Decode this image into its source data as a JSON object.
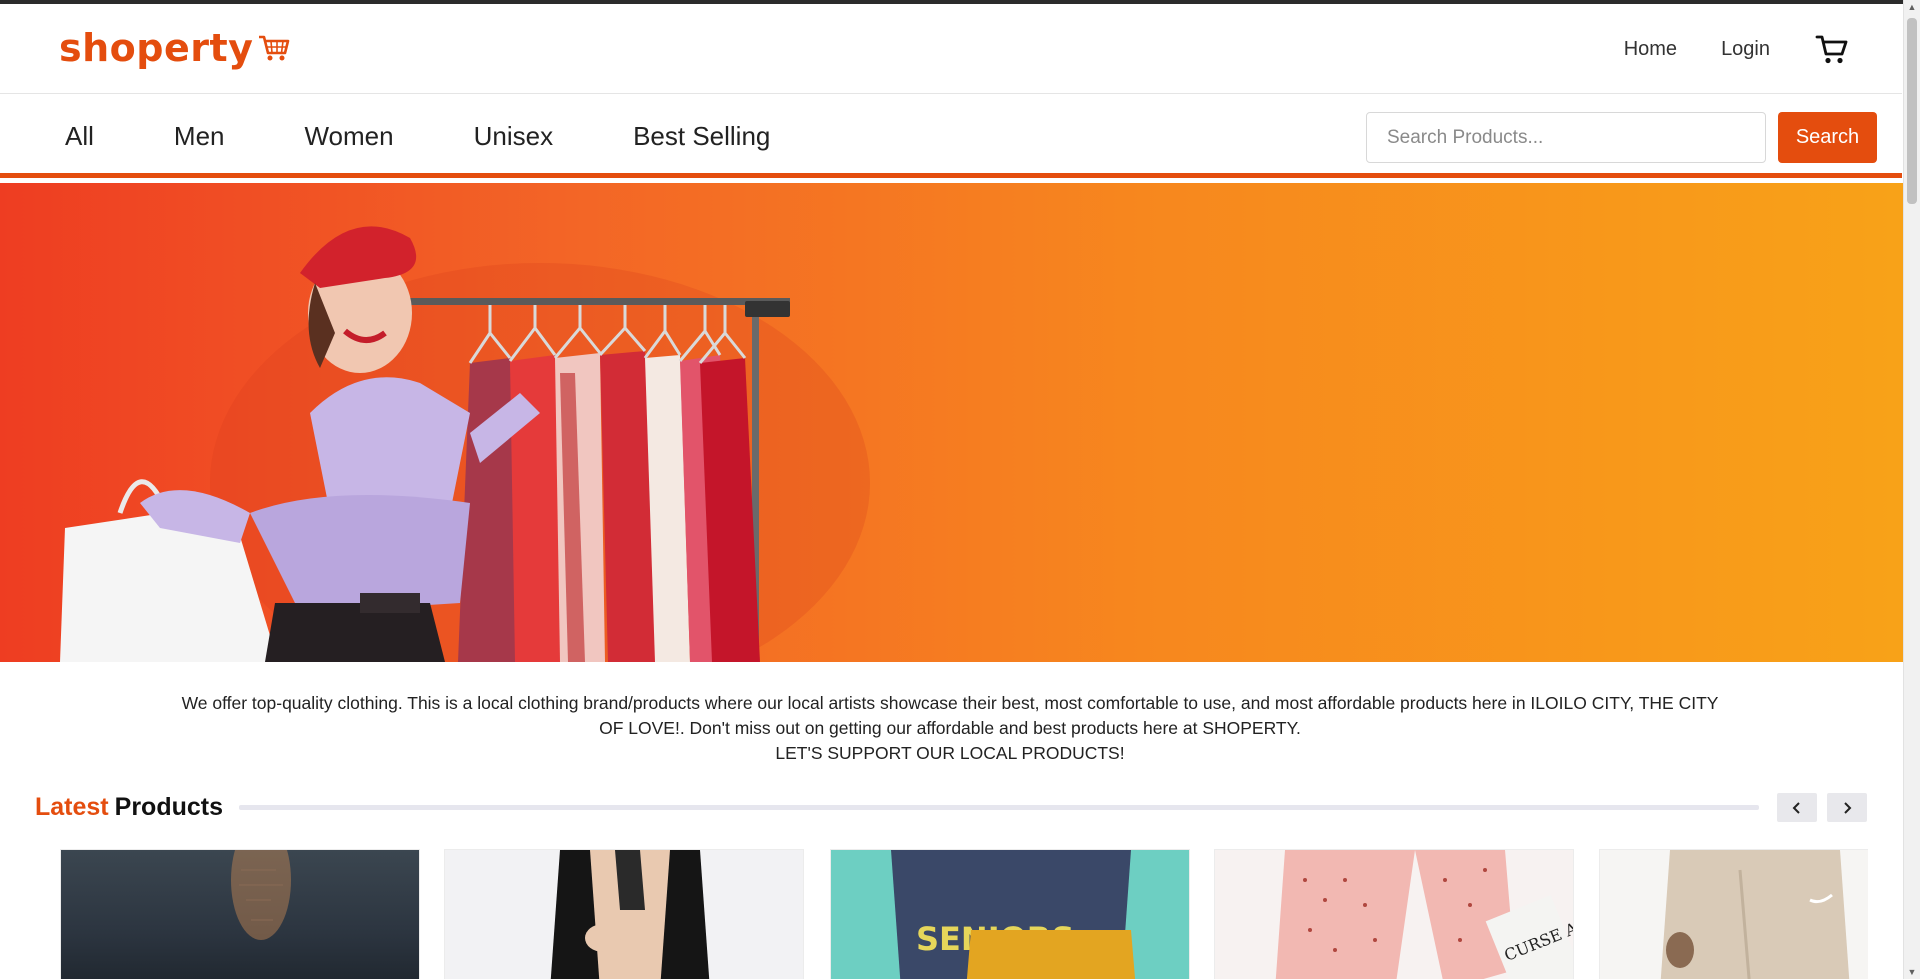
{
  "brand": {
    "name": "shoperty",
    "color": "#e44d0e"
  },
  "top_nav": {
    "home": "Home",
    "login": "Login"
  },
  "categories": [
    "All",
    "Men",
    "Women",
    "Unisex",
    "Best Selling"
  ],
  "search": {
    "placeholder": "Search Products...",
    "button": "Search"
  },
  "hero": {
    "image": "woman-with-clothing-rack-banner"
  },
  "about": {
    "line1": "We offer top-quality clothing. This is a local clothing brand/products where our local artists showcase their best, most comfortable to use, and most affordable products here in ILOILO CITY, THE CITY OF LOVE!. Don't miss out on getting our affordable and best products here at SHOPERTY.",
    "line2": "LET'S SUPPORT OUR LOCAL PRODUCTS!"
  },
  "latest_section": {
    "accent": "Latest",
    "rest": "Products"
  },
  "products": [
    {
      "image": "sunset-sea-photo"
    },
    {
      "image": "black-fur-vest"
    },
    {
      "image": "seniors-sweatshirts",
      "print_text": "SENIORS"
    },
    {
      "image": "pink-polka-dot-bikini",
      "tag_text": "CURSE ALITTLE"
    },
    {
      "image": "beige-sweatpants"
    }
  ]
}
